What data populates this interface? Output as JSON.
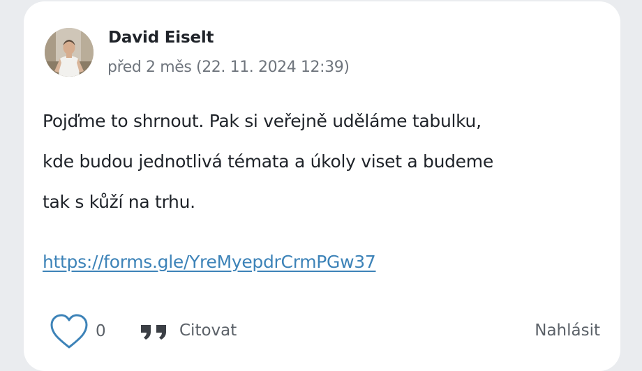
{
  "post": {
    "author": "David Eiselt",
    "timestamp": "před 2 měs (22. 11. 2024 12:39)",
    "body_lines": [
      "Pojďme to shrnout. Pak si veřejně uděláme tabulku,",
      "kde budou jednotlivá témata a úkoly viset a budeme",
      "tak s kůží na trhu."
    ],
    "link": "https://forms.gle/YreMyepdrCrmPGw37"
  },
  "actions": {
    "like_icon": "heart-outline-icon",
    "like_count": "0",
    "quote_icon": "quote-icon",
    "quote_label": "Citovat",
    "report_label": "Nahlásit"
  },
  "colors": {
    "link": "#3d83b8",
    "heart": "#3d83b8",
    "meta": "#6f757d"
  }
}
